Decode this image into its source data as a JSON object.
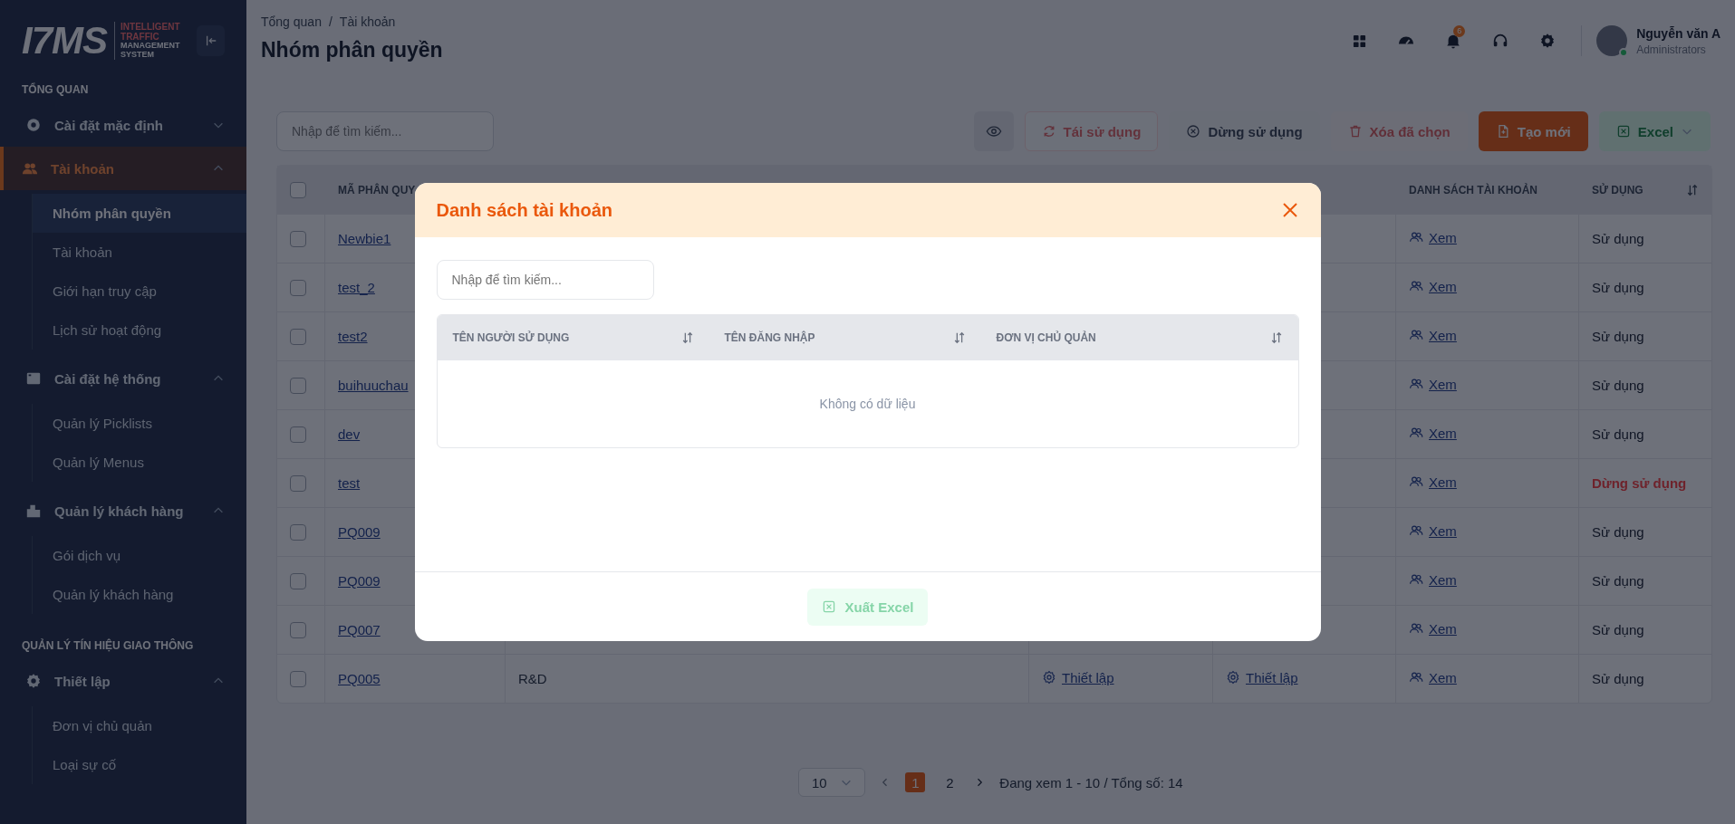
{
  "sidebar": {
    "logo": {
      "mark": "I7MS",
      "tagline_top": "INTELLIGENT TRAFFIC",
      "tagline_bottom": "MANAGEMENT SYSTEM"
    },
    "sections": [
      {
        "label": "TỔNG QUAN",
        "items": [
          {
            "label": "Cài đặt mặc định",
            "expanded": false,
            "selected": false
          },
          {
            "label": "Tài khoản",
            "expanded": true,
            "selected": true,
            "children": [
              {
                "label": "Nhóm phân quyền",
                "selected": true
              },
              {
                "label": "Tài khoản",
                "selected": false
              },
              {
                "label": "Giới hạn truy cập",
                "selected": false
              },
              {
                "label": "Lịch sử hoạt động",
                "selected": false
              }
            ]
          },
          {
            "label": "Cài đặt hệ thống",
            "expanded": true,
            "selected": false,
            "children": [
              {
                "label": "Quản lý Picklists",
                "selected": false
              },
              {
                "label": "Quản lý Menus",
                "selected": false
              }
            ]
          },
          {
            "label": "Quản lý khách hàng",
            "expanded": true,
            "selected": false,
            "children": [
              {
                "label": "Gói dịch vụ",
                "selected": false
              },
              {
                "label": "Quản lý khách hàng",
                "selected": false
              }
            ]
          }
        ]
      },
      {
        "label": "QUẢN LÝ TÍN HIỆU GIAO THÔNG",
        "items": [
          {
            "label": "Thiết lập",
            "expanded": true,
            "selected": false,
            "children": [
              {
                "label": "Đơn vị chủ quản",
                "selected": false
              },
              {
                "label": "Loại sự cố",
                "selected": false
              }
            ]
          }
        ]
      }
    ]
  },
  "header": {
    "breadcrumb": {
      "items": [
        "Tổng quan",
        "Tài khoản"
      ],
      "separator": "/"
    },
    "title": "Nhóm phân quyền",
    "notification_count": "6",
    "user": {
      "name": "Nguyễn văn A",
      "role": "Administrators",
      "online": true
    }
  },
  "toolbar": {
    "search": {
      "placeholder": "Nhập để tìm kiếm..."
    },
    "buttons": [
      {
        "kind": "view",
        "disabled": false
      },
      {
        "kind": "reuse",
        "label": "Tái sử dụng",
        "disabled": true
      },
      {
        "kind": "stop",
        "label": "Dừng sử dụng",
        "disabled": false
      },
      {
        "kind": "delete",
        "label": "Xóa đã chọn",
        "disabled": true
      },
      {
        "kind": "create",
        "label": "Tạo mới",
        "disabled": false
      },
      {
        "kind": "excel",
        "label": "Excel",
        "disabled": false
      }
    ]
  },
  "table": {
    "select_all": {
      "checked": false
    },
    "columns": [
      {
        "label": "MÃ PHÂN QUY",
        "sortable": false
      },
      {},
      {},
      {},
      {
        "label": "DANH SÁCH TÀI KHOẢN",
        "sortable": false
      },
      {
        "label": "SỬ DỤNG",
        "sortable": true
      }
    ],
    "rows": [
      {
        "checked": false,
        "code": "Newbie1",
        "accounts": "Xem",
        "status": "Sử dụng",
        "active": true
      },
      {
        "checked": false,
        "code": "test_2",
        "accounts": "Xem",
        "status": "Sử dụng",
        "active": true
      },
      {
        "checked": false,
        "code": "test2",
        "accounts": "Xem",
        "status": "Sử dụng",
        "active": true
      },
      {
        "checked": false,
        "code": "buihuuchau",
        "accounts": "Xem",
        "status": "Sử dụng",
        "active": true
      },
      {
        "checked": false,
        "code": "dev",
        "accounts": "Xem",
        "status": "Sử dụng",
        "active": true
      },
      {
        "checked": false,
        "code": "test",
        "accounts": "Xem",
        "status": "Dừng sử dụng",
        "active": false
      },
      {
        "checked": false,
        "code": "PQ009",
        "accounts": "Xem",
        "status": "Sử dụng",
        "active": true
      },
      {
        "checked": false,
        "code": "PQ009",
        "accounts": "Xem",
        "status": "Sử dụng",
        "active": true
      },
      {
        "checked": false,
        "code": "PQ007",
        "accounts": "Xem",
        "status": "Sử dụng",
        "active": true
      },
      {
        "checked": false,
        "code": "PQ005",
        "name": "R&D",
        "setup_1": "Thiết lập",
        "setup_2": "Thiết lập",
        "accounts": "Xem",
        "status": "Sử dụng",
        "active": true
      }
    ]
  },
  "pagination": {
    "page_size": "10",
    "pages": [
      {
        "label": "1",
        "selected": true
      },
      {
        "label": "2",
        "selected": false
      }
    ],
    "summary": "Đang xem 1 - 10 / Tổng số: 14"
  },
  "modal": {
    "title": "Danh sách tài khoản",
    "search": {
      "placeholder": "Nhập để tìm kiếm..."
    },
    "columns": [
      {
        "label": "TÊN NGƯỜI SỬ DỤNG",
        "sortable": true
      },
      {
        "label": "TÊN ĐĂNG NHẬP",
        "sortable": true
      },
      {
        "label": "ĐƠN VỊ CHỦ QUẢN",
        "sortable": true
      }
    ],
    "empty_text": "Không có dữ liệu",
    "export_button": {
      "label": "Xuất Excel",
      "disabled": true
    }
  }
}
